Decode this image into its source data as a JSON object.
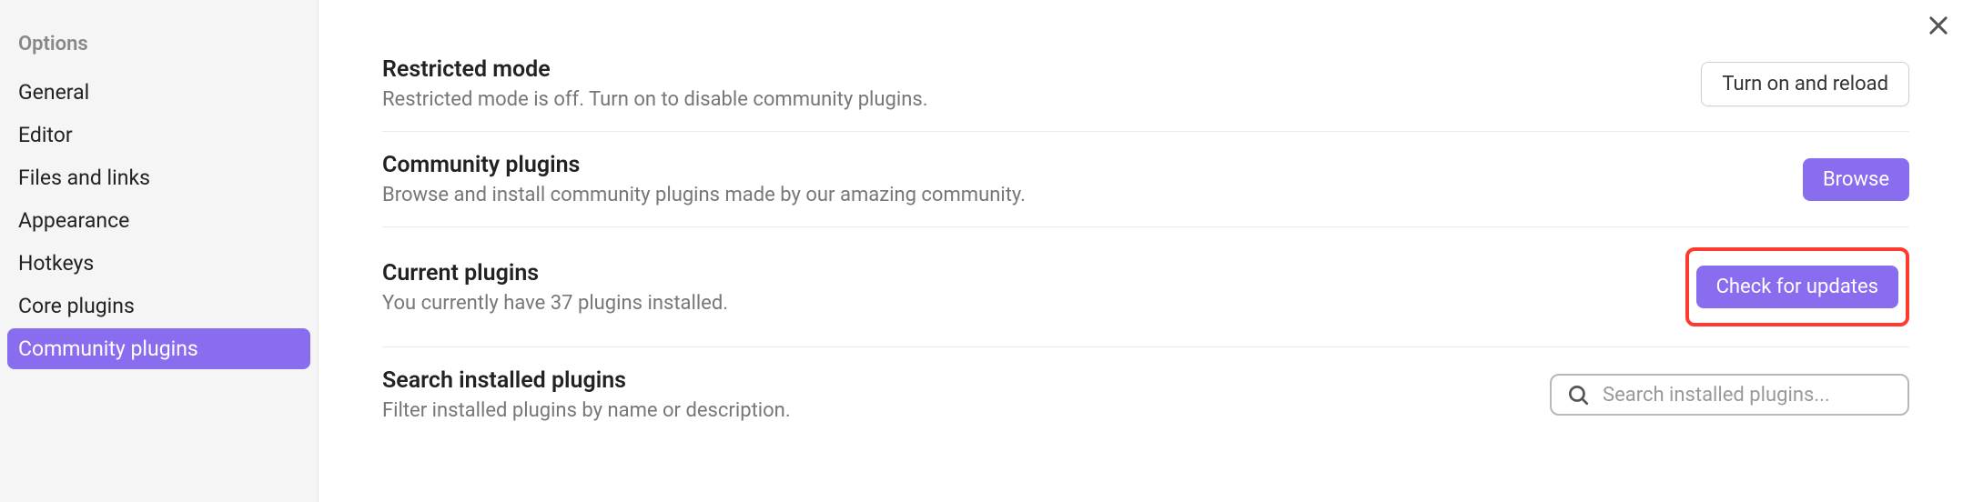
{
  "sidebar": {
    "heading": "Options",
    "items": [
      {
        "label": "General",
        "active": false
      },
      {
        "label": "Editor",
        "active": false
      },
      {
        "label": "Files and links",
        "active": false
      },
      {
        "label": "Appearance",
        "active": false
      },
      {
        "label": "Hotkeys",
        "active": false
      },
      {
        "label": "Core plugins",
        "active": false
      },
      {
        "label": "Community plugins",
        "active": true
      }
    ]
  },
  "settings": {
    "restricted_mode": {
      "title": "Restricted mode",
      "desc": "Restricted mode is off. Turn on to disable community plugins.",
      "button": "Turn on and reload"
    },
    "community_plugins": {
      "title": "Community plugins",
      "desc": "Browse and install community plugins made by our amazing community.",
      "button": "Browse"
    },
    "current_plugins": {
      "title": "Current plugins",
      "desc": "You currently have 37 plugins installed.",
      "button": "Check for updates"
    },
    "search": {
      "title": "Search installed plugins",
      "desc": "Filter installed plugins by name or description.",
      "placeholder": "Search installed plugins..."
    }
  }
}
